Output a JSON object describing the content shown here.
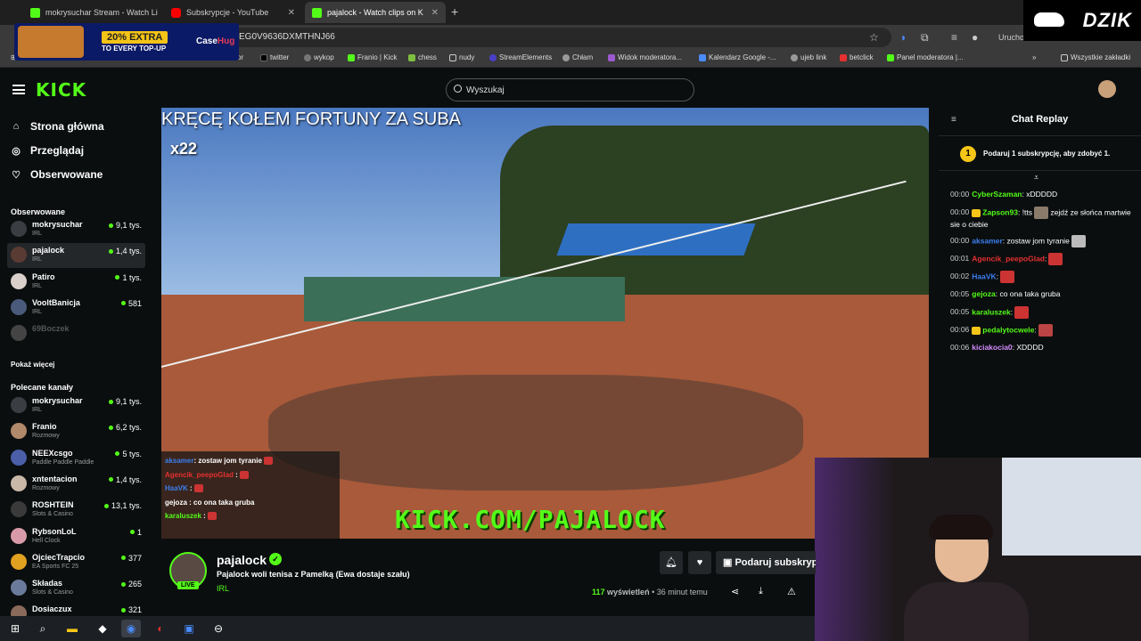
{
  "browser": {
    "tabs": [
      {
        "label": "mokrysuchar Stream - Watch Li",
        "favicon": "kick"
      },
      {
        "label": "Subskrypcje - YouTube",
        "favicon": "youtube"
      },
      {
        "label": "pajalock - Watch clips on K",
        "favicon": "kick",
        "active": true
      }
    ],
    "url": "EG0V9636DXMTHNJ66",
    "bookmarks": [
      "alior",
      "twitter",
      "wykop",
      "Franio | Kick",
      "chess",
      "nudy",
      "StreamElements",
      "Chłam",
      "Widok moderatora...",
      "Kalendarz Google -...",
      "ujeb link",
      "betclick",
      "Panel moderatora |..."
    ],
    "bookmarks_all": "Wszystkie zakładki",
    "extension_label": "Uruchom"
  },
  "ad": {
    "badge": "20% EXTRA",
    "sub": "TO EVERY TOP-UP",
    "brand_a": "Case",
    "brand_b": "Hug"
  },
  "dzik_logo": "DZIK",
  "kick": {
    "logo": "KICK",
    "search_placeholder": "Wyszukaj"
  },
  "sidebar": {
    "nav": [
      {
        "label": "Strona główna",
        "icon": "home-icon"
      },
      {
        "label": "Przeglądaj",
        "icon": "compass-icon"
      },
      {
        "label": "Obserwowane",
        "icon": "heart-icon"
      }
    ],
    "followed_title": "Obserwowane",
    "followed": [
      {
        "name": "mokrysuchar",
        "category": "IRL",
        "viewers": "9,1 tys.",
        "avatar_color": "#3a3d42"
      },
      {
        "name": "pajalock",
        "category": "IRL",
        "viewers": "1,4 tys.",
        "avatar_color": "#5a3b33",
        "selected": true
      },
      {
        "name": "Patiro",
        "category": "IRL",
        "viewers": "1 tys.",
        "avatar_color": "#d9d0cc"
      },
      {
        "name": "VooltBanicja",
        "category": "IRL",
        "viewers": "581",
        "avatar_color": "#4a5a7a"
      },
      {
        "name": "69Boczek",
        "category": "",
        "viewers": "",
        "avatar_color": "#444",
        "offline": true
      }
    ],
    "show_more": "Pokaż więcej",
    "recommended_title": "Polecane kanały",
    "recommended": [
      {
        "name": "mokrysuchar",
        "category": "IRL",
        "viewers": "9,1 tys.",
        "avatar_color": "#3a3d42"
      },
      {
        "name": "Franio",
        "category": "Rozmowy",
        "viewers": "6,2 tys.",
        "avatar_color": "#b08a6a"
      },
      {
        "name": "NEEXcsgo",
        "category": "Paddle Paddle Paddle",
        "viewers": "5 tys.",
        "avatar_color": "#4a5fa8"
      },
      {
        "name": "xntentacion",
        "category": "Rozmowy",
        "viewers": "1,4 tys.",
        "avatar_color": "#c9b8a8"
      },
      {
        "name": "ROSHTEIN",
        "category": "Slots & Casino",
        "viewers": "13,1 tys.",
        "avatar_color": "#3a3a3a"
      },
      {
        "name": "RybsonLoL",
        "category": "Hell Clock",
        "viewers": "1",
        "avatar_color": "#d99aa8"
      },
      {
        "name": "OjciecTrapcio",
        "category": "EA Sports FC 25",
        "viewers": "377",
        "avatar_color": "#e0a020"
      },
      {
        "name": "Składas",
        "category": "Slots & Casino",
        "viewers": "265",
        "avatar_color": "#6a7a9a"
      },
      {
        "name": "Dosiaczux",
        "category": "",
        "viewers": "321",
        "avatar_color": "#8a6a5a"
      }
    ]
  },
  "video": {
    "overlay_title": "KRĘCĘ KOŁEM FORTUNY ZA SUBA",
    "overlay_count": "x22",
    "overlay_url": "KICK.COM/PAJALOCK",
    "overlay_chat": [
      {
        "user": "aksamer",
        "color": "#3b7ff0",
        "msg": ": zostaw jom tyranie",
        "emote": true
      },
      {
        "user": "Agencik_peepoGlad",
        "color": "#e53030",
        "msg": " :",
        "emote": true
      },
      {
        "user": "HaaVK",
        "color": "#3b7ff0",
        "msg": " :",
        "emote": true
      },
      {
        "user": "gejoza",
        "color": "#ffffff",
        "msg": " : co ona taka gruba",
        "emote": false
      },
      {
        "user": "karaluszek",
        "color": "#53fc18",
        "msg": " :",
        "emote": true
      }
    ]
  },
  "stream": {
    "streamer": "pajalock",
    "live": "LIVE",
    "title": "Pajalock woli tenisa z Pamelką (Ewa dostaje szału)",
    "category": "IRL",
    "views_count": "117",
    "views_label": "wyświetleń",
    "time_ago": "• 36 minut temu",
    "gift_label": "Podaruj subskrypcję"
  },
  "chat": {
    "title": "Chat Replay",
    "pinned_badge": "1",
    "pinned_text": "Podaruj 1 subskrypcję, aby zdobyć 1.",
    "messages": [
      {
        "ts": "00:00",
        "user": "CyberSzaman",
        "color": "#53fc18",
        "text": ": xDDDDD",
        "badge": false,
        "emote": ""
      },
      {
        "ts": "00:00",
        "user": "Zapson93",
        "color": "#53fc18",
        "text": ": !tts",
        "badge": true,
        "emote": "#8a7a6a",
        "text2": " zejdź ze słońca martwie sie o ciebie"
      },
      {
        "ts": "00:00",
        "user": "aksamer",
        "color": "#3b7ff0",
        "text": ": zostaw jom tyranie",
        "badge": false,
        "emote": "#bbbbbb"
      },
      {
        "ts": "00:01",
        "user": "Agencik_peepoGlad",
        "color": "#e53030",
        "text": ":",
        "badge": false,
        "emote": "#c33"
      },
      {
        "ts": "00:02",
        "user": "HaaVK",
        "color": "#3b7ff0",
        "text": ":",
        "badge": false,
        "emote": "#c33"
      },
      {
        "ts": "00:05",
        "user": "gejoza",
        "color": "#53fc18",
        "text": ": co ona taka gruba",
        "badge": false,
        "emote": ""
      },
      {
        "ts": "00:05",
        "user": "karaluszek",
        "color": "#53fc18",
        "text": ":",
        "badge": false,
        "emote": "#c33"
      },
      {
        "ts": "00:06",
        "user": "pedalytocwele",
        "color": "#53fc18",
        "text": ":",
        "badge": true,
        "emote": "#b44"
      },
      {
        "ts": "00:06",
        "user": "kiciakocia0",
        "color": "#d38cff",
        "text": ": XDDDD",
        "badge": false,
        "emote": ""
      }
    ]
  },
  "taskbar": [
    "windows-icon",
    "search-icon",
    "file-explorer-icon",
    "app-icon",
    "chrome-icon",
    "app-icon-2",
    "app-icon-3",
    "app-icon-4"
  ]
}
